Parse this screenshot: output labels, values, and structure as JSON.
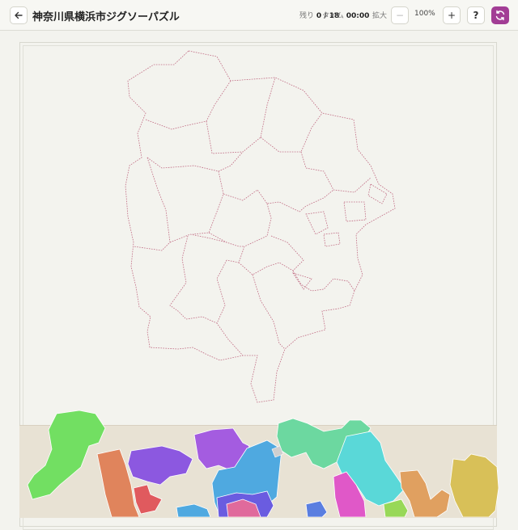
{
  "header": {
    "title": "神奈川県横浜市ジグソーパズル",
    "remaining_label": "残り",
    "remaining_value": "0 / 18",
    "time_label": "タイム",
    "time_value": "00:00",
    "zoom_label": "拡大",
    "zoom_out": "−",
    "zoom_value": "100%",
    "zoom_in": "+",
    "help": "?"
  },
  "icons": {
    "back": "arrow-left-icon",
    "reset": "refresh-icon"
  },
  "colors": {
    "accent": "#a23d95",
    "outline": "#c06a82"
  }
}
